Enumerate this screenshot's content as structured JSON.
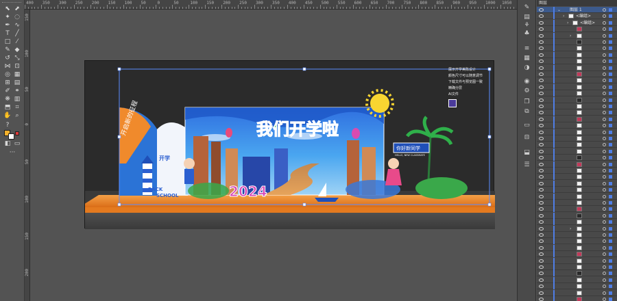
{
  "ruler": {
    "top_labels": [
      "400",
      "350",
      "300",
      "250",
      "200",
      "150",
      "100",
      "50",
      "0",
      "50",
      "100",
      "150",
      "200",
      "250",
      "300",
      "350",
      "400",
      "450",
      "500",
      "550",
      "600",
      "650",
      "700",
      "750",
      "800",
      "850",
      "900",
      "950",
      "1000",
      "1050"
    ],
    "left_labels": [
      "150",
      "100",
      "50",
      "0",
      "50",
      "100",
      "150",
      "200"
    ]
  },
  "colors": {
    "accent": "#4f7ee6",
    "selection": "#3c5a8c",
    "stage_orange": "#f08a2c",
    "backdrop_blue": "#2f6fe0"
  },
  "artwork": {
    "headline": "我们开学啦",
    "year": "2024",
    "left_arc_text": "开启新的征程",
    "left_sign_text": "BACK SCHOOL",
    "welcome_sign": "你好新同学",
    "welcome_sign_sub": "HELLO, NEW CLASSMATE",
    "notes": [
      "展示开学美陈设计",
      "颜色尺寸可以随意调节",
      "下载文件与预览图一致",
      "精确分层",
      "AI文件"
    ]
  },
  "layers_panel": {
    "tab_label": "图层",
    "top_layer": "图层 1",
    "group_label": "<编组>",
    "row_count": 46
  }
}
